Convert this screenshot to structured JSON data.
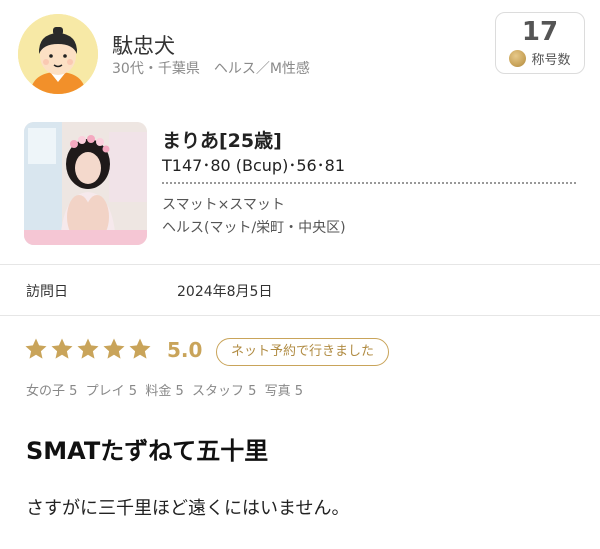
{
  "reviewer": {
    "name": "駄忠犬",
    "meta": "30代・千葉県　ヘルス／M性感",
    "title_count": "17",
    "title_label": "称号数"
  },
  "girl": {
    "name": "まりあ[25歳]",
    "stats": "T147･80 (Bcup)･56･81",
    "shop": "スマット×スマット",
    "area": "ヘルス(マット/栄町・中央区)"
  },
  "visit": {
    "label": "訪問日",
    "date": "2024年8月5日"
  },
  "rating": {
    "score": "5.0",
    "stars": 5,
    "badge": "ネット予約で行きました",
    "subscores": "女の子 5  プレイ 5  料金 5  スタッフ 5  写真 5",
    "accent_color": "#c9a45a"
  },
  "review": {
    "title": "SMATたずねて五十里",
    "body": "さすがに三千里ほど遠くにはいません。"
  }
}
